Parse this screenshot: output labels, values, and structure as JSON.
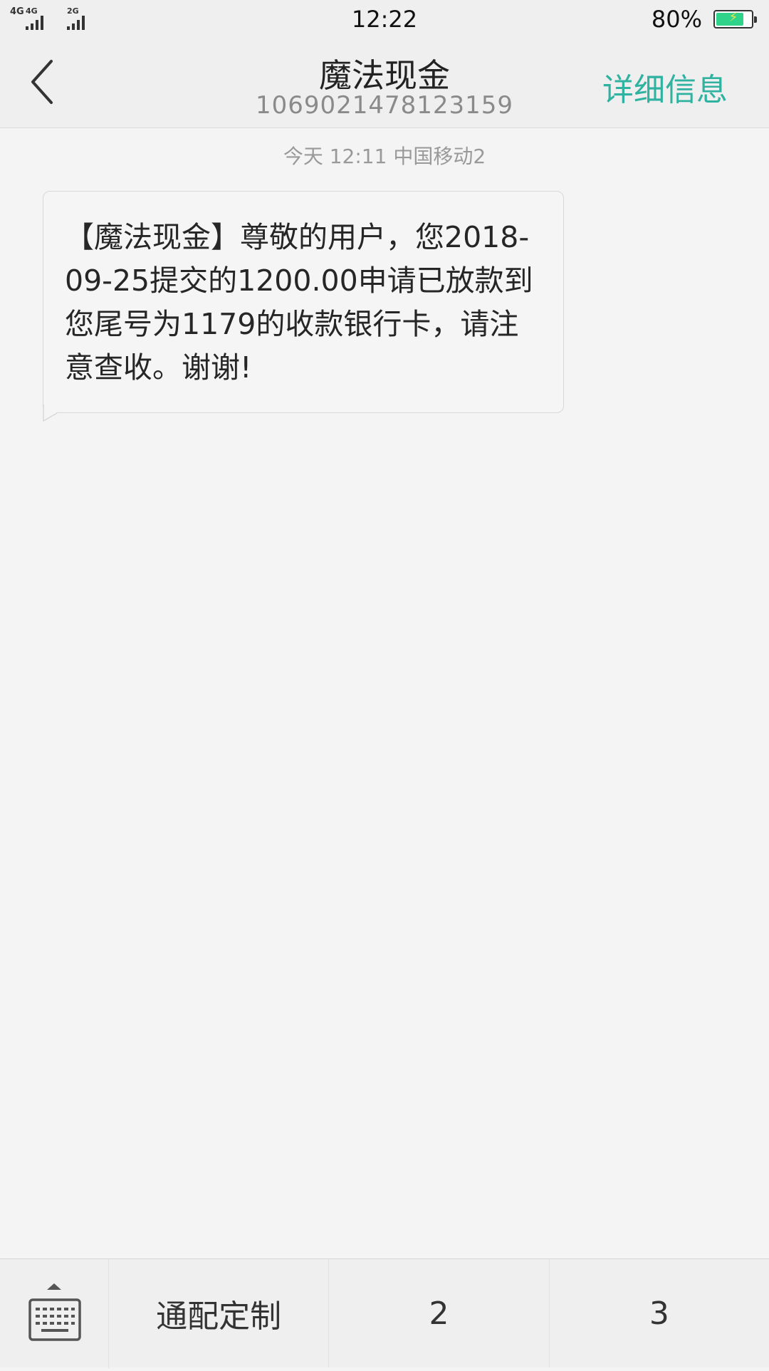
{
  "status_bar": {
    "signal1_label": "4G",
    "signal2_label": "4G",
    "signal3_label": "2G",
    "time": "12:22",
    "battery_percent_text": "80%",
    "battery_level": 0.8
  },
  "header": {
    "back_icon": "chevron-left-icon",
    "title": "魔法现金",
    "phone_number": "1069021478123159",
    "details_label": "详细信息"
  },
  "conversation": {
    "timestamp": "今天  12:11   中国移动2",
    "messages": [
      {
        "direction": "incoming",
        "text": "【魔法现金】尊敬的用户，您2018-09-25提交的1200.00申请已放款到您尾号为1179的收款银行卡，请注意查收。谢谢!"
      }
    ]
  },
  "bottom_bar": {
    "keyboard_icon": "keyboard-icon",
    "quick_replies": [
      "通配定制",
      "2",
      "3"
    ]
  },
  "colors": {
    "accent": "#2fb3a0",
    "background": "#f4f4f4",
    "bar_background": "#efefef",
    "battery_fill": "#2fd38a"
  }
}
